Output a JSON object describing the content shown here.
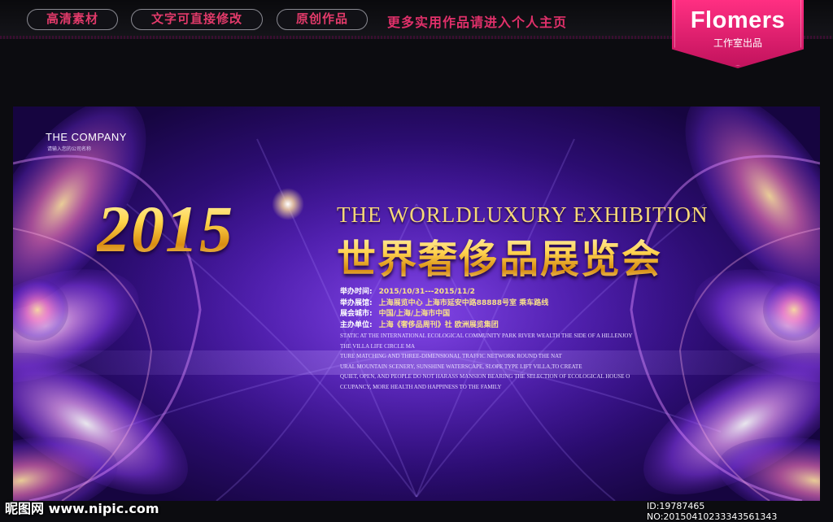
{
  "topbar": {
    "pills": [
      "高清素材",
      "文字可直接修改",
      "原创作品"
    ],
    "more_text": "更多实用作品请进入个人主页",
    "badge_brand": "Flomers",
    "badge_sub": "工作室出品",
    "accent_color": "#e23a6a",
    "badge_color": "#ff2f82"
  },
  "banner": {
    "company_name": "THE COMPANY",
    "company_sub": "请输入您的公司名称",
    "year": "2015",
    "title_en": "THE WORLDLUXURY EXHIBITION",
    "title_cn": "世界奢侈品展览会",
    "info": [
      {
        "label": "举办时间:",
        "value": "2015/10/31---2015/11/2"
      },
      {
        "label": "举办展馆:",
        "value": "上海展览中心  上海市延安中路88888号室  乘车路线"
      },
      {
        "label": "展会城市:",
        "value": "中国/上海/上海市中国"
      },
      {
        "label": "主办单位:",
        "value": "上海《奢侈品周刊》社  欧洲展览集团"
      }
    ],
    "description": [
      "STATIC AT THE INTERNATIONAL ECOLOGICAL COMMUNITY PARK RIVER WEALTH THE SIDE OF A HILLENJOY",
      "THE VILLA LIFE CIRCLE MA",
      "TURE MATCHING AND THREE-DIMENSIONAL TRAFFIC NETWORK ROUND THE NAT",
      "URAL MOUNTAIN SCENERY, SUNSHINE WATERSCAPE, SLOPE TYPE LIFT VILLA,TO CREATE",
      "QUIET, OPEN, AND PEOPLE DO NOT HARASS MANSION BEARING THE SELECTION OF ECOLOGICAL HOUSE O",
      "CCUPANCY, MORE HEALTH AND HAPPINESS TO THE FAMILY"
    ]
  },
  "watermark": {
    "site": "昵图网 www.nipic.com",
    "id_text": "ID:19787465 NO:20150410233343561343"
  }
}
